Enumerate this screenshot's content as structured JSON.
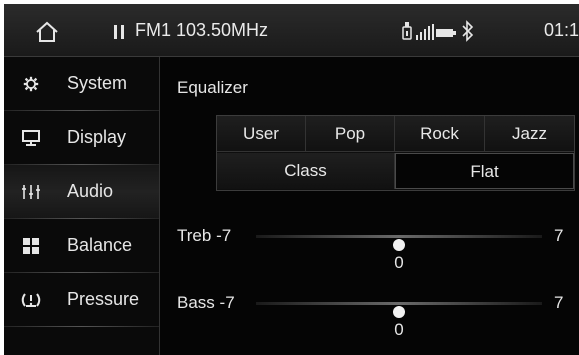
{
  "statusbar": {
    "station": "FM1 103.50MHz",
    "clock": "01:1",
    "icons": [
      "home-icon",
      "pause-icon",
      "usb-icon",
      "signal-icon",
      "battery-icon",
      "bluetooth-icon"
    ]
  },
  "sidebar": {
    "items": [
      {
        "label": "System",
        "icon": "gear-icon"
      },
      {
        "label": "Display",
        "icon": "monitor-icon"
      },
      {
        "label": "Audio",
        "icon": "equalizer-icon"
      },
      {
        "label": "Balance",
        "icon": "balance-icon"
      },
      {
        "label": "Pressure",
        "icon": "tire-pressure-icon"
      }
    ],
    "active_index": 2
  },
  "equalizer": {
    "title": "Equalizer",
    "presets": [
      "User",
      "Pop",
      "Rock",
      "Jazz",
      "Class",
      "Flat"
    ],
    "selected": "Flat"
  },
  "sliders": [
    {
      "label": "Treb",
      "min": "-7",
      "max": "7",
      "value": "0",
      "min_value": -7,
      "max_value": 7,
      "current": 0
    },
    {
      "label": "Bass",
      "min": "-7",
      "max": "7",
      "value": "0",
      "min_value": -7,
      "max_value": 7,
      "current": 0
    }
  ],
  "colors": {
    "background": "#050505",
    "text": "#e6e6e6",
    "accent": "#f2f2f2"
  }
}
